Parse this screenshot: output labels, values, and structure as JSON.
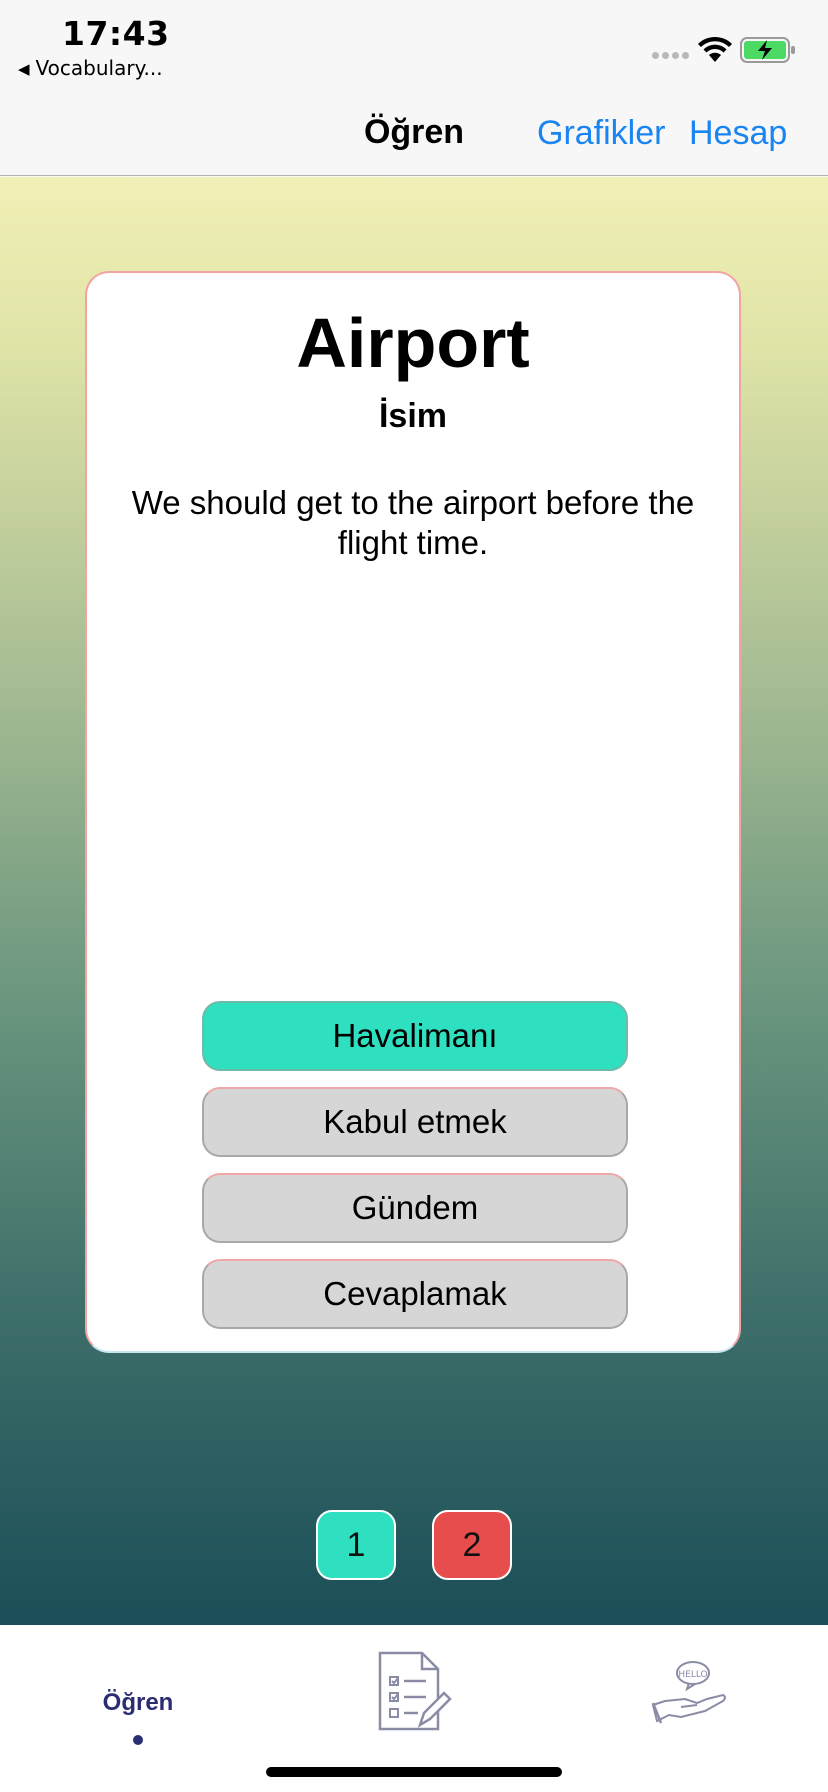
{
  "status_bar": {
    "time": "17:43",
    "back_app_label": "Vocabulary...",
    "back_icon": "back-triangle-icon",
    "wifi_icon": "wifi-icon",
    "battery_icon": "battery-charging-icon",
    "battery_color": "#4cd964"
  },
  "nav": {
    "title": "Öğren",
    "charts_label": "Grafikler",
    "account_label": "Hesap",
    "link_color": "#1a84f2"
  },
  "card": {
    "word": "Airport",
    "part_of_speech": "İsim",
    "example": "We should get to the airport before the flight time.",
    "options": [
      {
        "label": "Havalimanı",
        "state": "correct"
      },
      {
        "label": "Kabul etmek",
        "state": "default"
      },
      {
        "label": "Gündem",
        "state": "default"
      },
      {
        "label": "Cevaplamak",
        "state": "default"
      }
    ],
    "correct_color": "#2fe0c0",
    "option_color": "#d6d6d6"
  },
  "pages": [
    {
      "label": "1",
      "color": "#2fe0c0"
    },
    {
      "label": "2",
      "color": "#e84d4d"
    }
  ],
  "tab_bar": {
    "learn_label": "Öğren",
    "test_icon": "test-checklist-icon",
    "hello_icon": "hello-hand-icon",
    "active_color": "#2b2d72"
  }
}
